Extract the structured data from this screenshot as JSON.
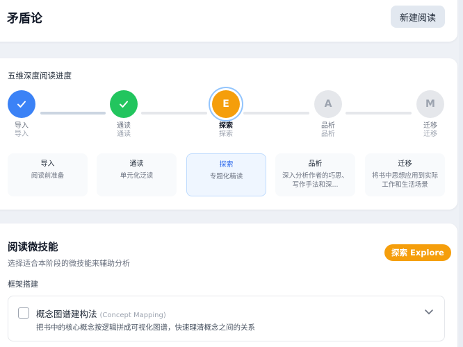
{
  "header": {
    "title": "矛盾论",
    "new_button": "新建阅读"
  },
  "progress": {
    "title": "五维深度阅读进度",
    "steps": [
      {
        "symbol": "✓",
        "label": "导入",
        "sub": "导入",
        "state": "done",
        "icon": "check-icon"
      },
      {
        "symbol": "✓",
        "label": "通读",
        "sub": "通读",
        "state": "done",
        "icon": "check-icon"
      },
      {
        "symbol": "E",
        "label": "探索",
        "sub": "探索",
        "state": "current"
      },
      {
        "symbol": "A",
        "label": "品析",
        "sub": "品析",
        "state": "todo"
      },
      {
        "symbol": "M",
        "label": "迁移",
        "sub": "迁移",
        "state": "todo"
      }
    ],
    "stages": [
      {
        "name": "导入",
        "desc": "阅读前准备"
      },
      {
        "name": "通读",
        "desc": "单元化泛读"
      },
      {
        "name": "探索",
        "desc": "专题化精读"
      },
      {
        "name": "品析",
        "desc": "深入分析作者的巧思、写作手法和深..."
      },
      {
        "name": "迁移",
        "desc": "将书中思想应用到实际工作和生活场景"
      }
    ]
  },
  "skills": {
    "title": "阅读微技能",
    "subtitle": "选择适合本阶段的微技能来辅助分析",
    "badge": "探索 Explore",
    "group": "框架搭建",
    "items": [
      {
        "name": "概念图谱建构法",
        "name_en": "(Concept Mapping)",
        "desc": "把书中的核心概念按逻辑拼成可视化图谱，快速理清概念之间的关系",
        "checked": false
      }
    ]
  },
  "colors": {
    "blue": "#3b82f6",
    "green": "#22c55e",
    "orange": "#f59e0b",
    "gray": "#e5e7eb"
  }
}
